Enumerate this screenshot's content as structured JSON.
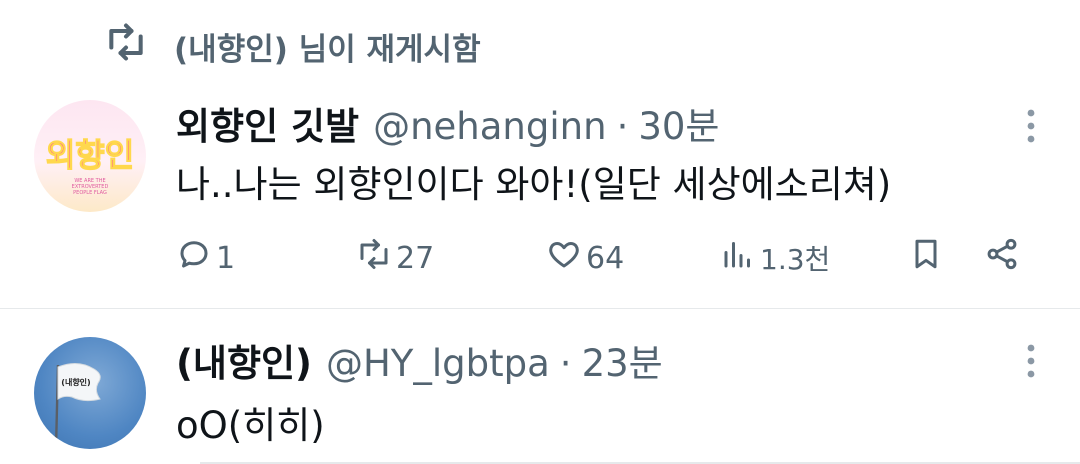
{
  "retweet_banner": {
    "text": "(내향인) 님이 재게시함",
    "icon": "retweet-icon"
  },
  "tweets": [
    {
      "display_name": "외향인 깃발",
      "handle": "@nehanginn",
      "separator": "·",
      "time": "30분",
      "text": "나..나는 외향인이다 와아!(일단 세상에소리쳐)",
      "avatar_text": "외향인",
      "avatar_small_lines": [
        "WE ARE THE",
        "EXTROVERTED",
        "PEOPLE FLAG"
      ],
      "stats": {
        "replies": "1",
        "reposts": "27",
        "likes": "64",
        "views": "1.3천"
      }
    },
    {
      "display_name": "(내향인)",
      "handle": "@HY_lgbtpa",
      "separator": "·",
      "time": "23분",
      "text": "oO(히히)",
      "avatar_flag_text": "(내향인)"
    }
  ],
  "colors": {
    "text": "#0f1419",
    "secondary": "#536471",
    "divider": "#e6e9eb",
    "avatar_pink": "#ff3aa6"
  }
}
